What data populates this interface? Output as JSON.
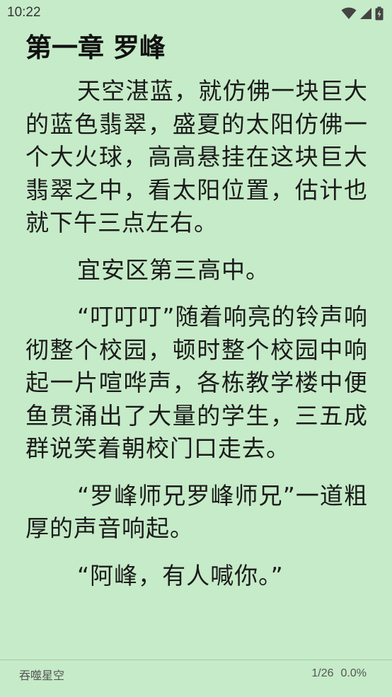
{
  "status": {
    "time": "10:22",
    "icons": [
      "wifi-icon",
      "signal-icon",
      "battery-icon"
    ]
  },
  "chapter": {
    "title": "第一章 罗峰",
    "paragraphs": [
      "天空湛蓝，就仿佛一块巨大的蓝色翡翠，盛夏的太阳仿佛一个大火球，高高悬挂在这块巨大翡翠之中，看太阳位置，估计也就下午三点左右。",
      "宜安区第三高中。",
      "“叮叮叮”随着响亮的铃声响彻整个校园，顿时整个校园中响起一片喧哗声，各栋教学楼中便鱼贯涌出了大量的学生，三五成群说笑着朝校门口走去。",
      "“罗峰师兄罗峰师兄”一道粗厚的声音响起。",
      "“阿峰，有人喊你。”"
    ]
  },
  "footer": {
    "book_title": "吞噬星空",
    "page": "1/26",
    "percent": "0.0%"
  },
  "colors": {
    "background": "#c6ebc8",
    "text": "#1b1b1b"
  }
}
